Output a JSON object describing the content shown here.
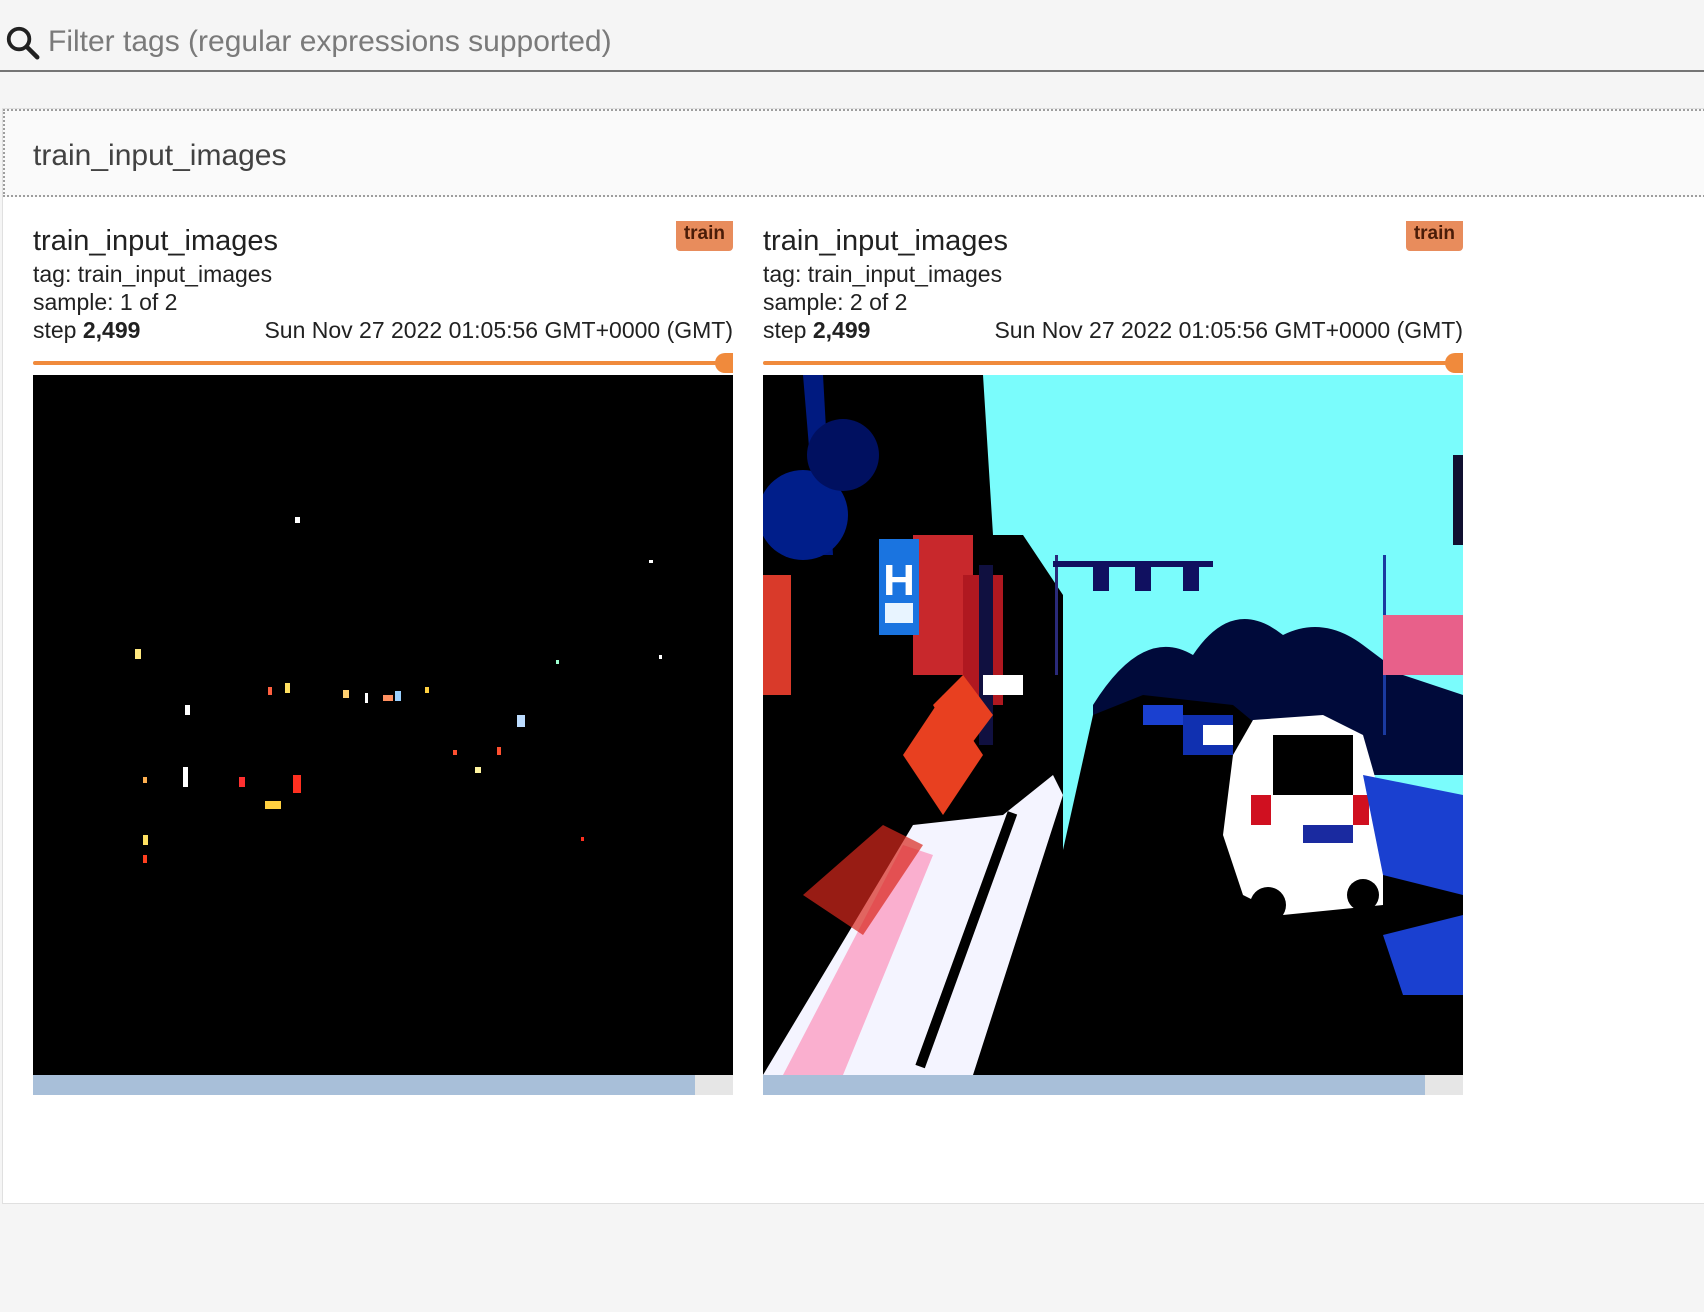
{
  "search": {
    "placeholder": "Filter tags (regular expressions supported)",
    "icon": "search-icon"
  },
  "category": {
    "title": "train_input_images"
  },
  "cards": [
    {
      "title": "train_input_images",
      "run_badge": "train",
      "tag_line": "tag: train_input_images",
      "sample_line": "sample: 1 of 2",
      "step_label": "step",
      "step_value": "2,499",
      "wall_time": "Sun Nov 27 2022 01:05:56 GMT+0000 (GMT)",
      "slider_position": 1.0,
      "image_description_icon": "night-street-image"
    },
    {
      "title": "train_input_images",
      "run_badge": "train",
      "tag_line": "tag: train_input_images",
      "sample_line": "sample: 2 of 2",
      "step_label": "step",
      "step_value": "2,499",
      "wall_time": "Sun Nov 27 2022 01:05:56 GMT+0000 (GMT)",
      "slider_position": 1.0,
      "image_description_icon": "day-street-image"
    }
  ],
  "colors": {
    "accent": "#f08a3c",
    "badge": "#e88c5c",
    "scroll_thumb": "#a8bfd9"
  }
}
